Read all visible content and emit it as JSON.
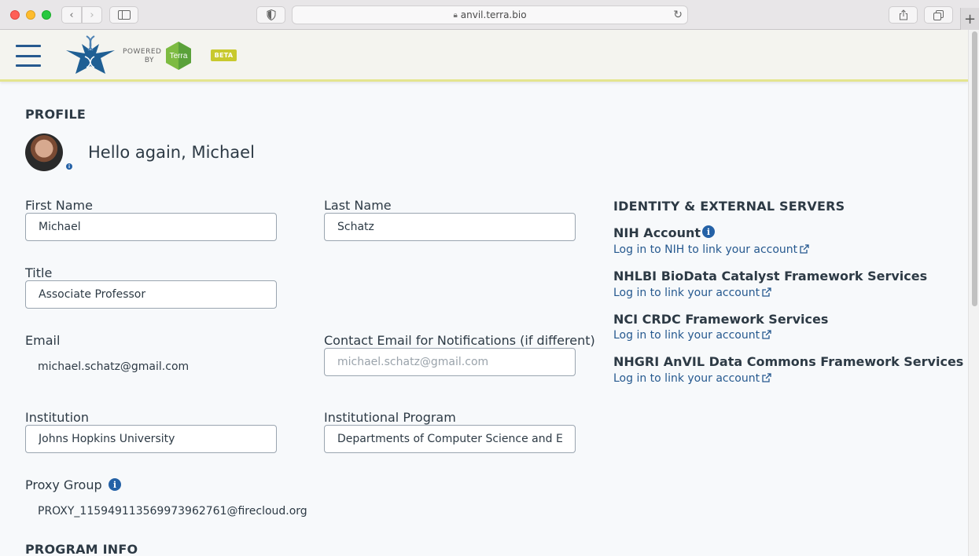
{
  "browser": {
    "url": "anvil.terra.bio"
  },
  "header": {
    "powered_by_line1": "POWERED",
    "powered_by_line2": "BY",
    "terra_label": "Terra",
    "beta_badge": "BETA"
  },
  "profile": {
    "section_title": "PROFILE",
    "greeting": "Hello again, Michael",
    "first_name_label": "First Name",
    "first_name_value": "Michael",
    "last_name_label": "Last Name",
    "last_name_value": "Schatz",
    "title_label": "Title",
    "title_value": "Associate Professor",
    "email_label": "Email",
    "email_value": "michael.schatz@gmail.com",
    "contact_email_label": "Contact Email for Notifications (if different)",
    "contact_email_placeholder": "michael.schatz@gmail.com",
    "institution_label": "Institution",
    "institution_value": "Johns Hopkins University",
    "program_label": "Institutional Program",
    "program_value": "Departments of Computer Science and E",
    "proxy_label": "Proxy Group",
    "proxy_value": "PROXY_115949113569973962761@firecloud.org"
  },
  "identity": {
    "section_title": "IDENTITY & EXTERNAL SERVERS",
    "services": [
      {
        "title": "NIH Account",
        "link": "Log in to NIH to link your account"
      },
      {
        "title": "NHLBI BioData Catalyst Framework Services",
        "link": "Log in to link your account"
      },
      {
        "title": "NCI CRDC Framework Services",
        "link": "Log in to link your account"
      },
      {
        "title": "NHGRI AnVIL Data Commons Framework Services",
        "link": "Log in to link your account"
      }
    ]
  },
  "program_info": {
    "section_title": "PROGRAM INFO"
  },
  "colors": {
    "accent": "#26598f",
    "beta": "#c8c92e",
    "header_border": "#e4e58f"
  }
}
